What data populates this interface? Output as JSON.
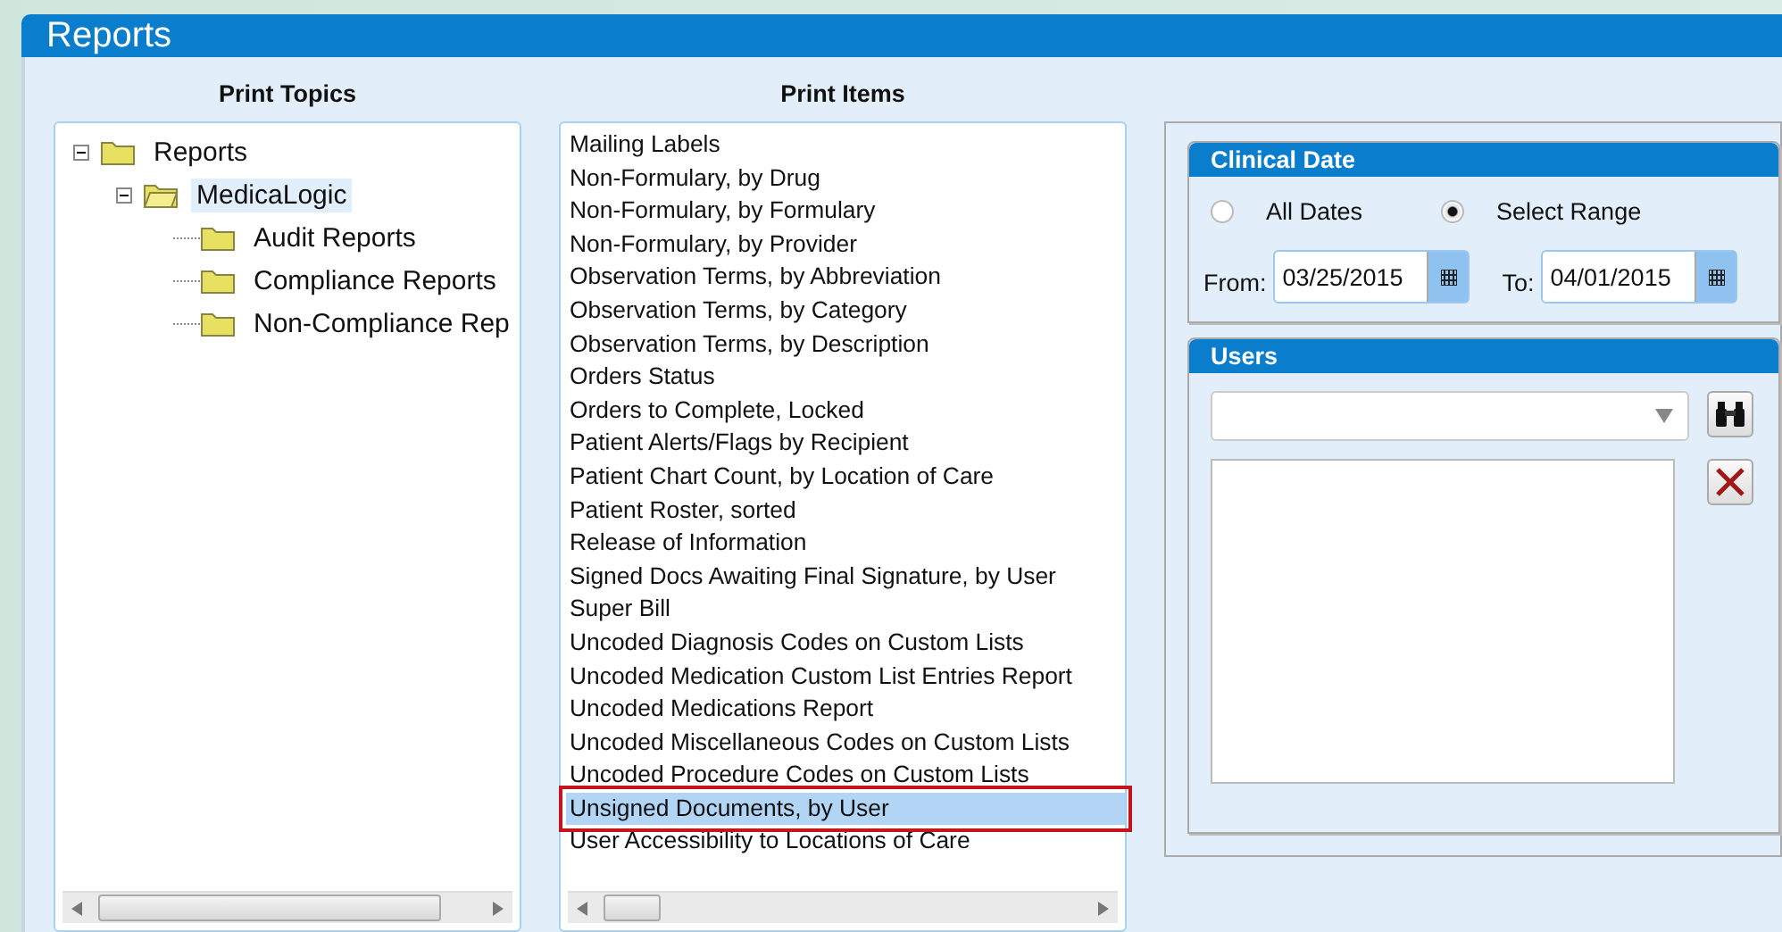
{
  "window": {
    "title": "Reports"
  },
  "print_topics": {
    "heading": "Print Topics",
    "tree": [
      {
        "label": "Reports",
        "expanded": true,
        "selected": false,
        "children": [
          {
            "label": "MedicaLogic",
            "expanded": true,
            "selected": true,
            "children": [
              {
                "label": "Audit Reports",
                "selected": false
              },
              {
                "label": "Compliance Reports",
                "selected": false
              },
              {
                "label": "Non-Compliance Rep",
                "selected": false
              }
            ]
          }
        ]
      }
    ]
  },
  "print_items": {
    "heading": "Print Items",
    "items": [
      {
        "label": "Mailing Labels",
        "selected": false,
        "outlined": false
      },
      {
        "label": "Non-Formulary, by Drug",
        "selected": false,
        "outlined": false
      },
      {
        "label": "Non-Formulary, by Formulary",
        "selected": false,
        "outlined": false
      },
      {
        "label": "Non-Formulary, by Provider",
        "selected": false,
        "outlined": false
      },
      {
        "label": "Observation Terms, by Abbreviation",
        "selected": false,
        "outlined": false
      },
      {
        "label": "Observation Terms, by Category",
        "selected": false,
        "outlined": false
      },
      {
        "label": "Observation Terms, by Description",
        "selected": false,
        "outlined": false
      },
      {
        "label": "Orders Status",
        "selected": false,
        "outlined": false
      },
      {
        "label": "Orders to Complete, Locked",
        "selected": false,
        "outlined": false
      },
      {
        "label": "Patient Alerts/Flags by Recipient",
        "selected": false,
        "outlined": false
      },
      {
        "label": "Patient Chart Count, by Location of Care",
        "selected": false,
        "outlined": false
      },
      {
        "label": "Patient Roster, sorted",
        "selected": false,
        "outlined": false
      },
      {
        "label": "Release of Information",
        "selected": false,
        "outlined": false
      },
      {
        "label": "Signed Docs Awaiting Final Signature, by User",
        "selected": false,
        "outlined": false
      },
      {
        "label": "Super Bill",
        "selected": false,
        "outlined": false
      },
      {
        "label": "Uncoded Diagnosis Codes on Custom Lists",
        "selected": false,
        "outlined": false
      },
      {
        "label": "Uncoded Medication Custom List Entries Report",
        "selected": false,
        "outlined": false
      },
      {
        "label": "Uncoded Medications Report",
        "selected": false,
        "outlined": false
      },
      {
        "label": "Uncoded Miscellaneous Codes on Custom Lists",
        "selected": false,
        "outlined": false
      },
      {
        "label": "Uncoded Procedure Codes on Custom Lists",
        "selected": false,
        "outlined": false
      },
      {
        "label": "Unsigned Documents, by User",
        "selected": true,
        "outlined": true
      },
      {
        "label": "User Accessibility to Locations of Care",
        "selected": false,
        "outlined": false
      }
    ]
  },
  "clinical_date": {
    "title": "Clinical Date",
    "options": [
      {
        "label": "All Dates",
        "selected": false
      },
      {
        "label": "Select Range",
        "selected": true
      }
    ],
    "from": {
      "label": "From:",
      "value": "03/25/2015"
    },
    "to": {
      "label": "To:",
      "value": "04/01/2015"
    }
  },
  "users": {
    "title": "Users"
  }
}
